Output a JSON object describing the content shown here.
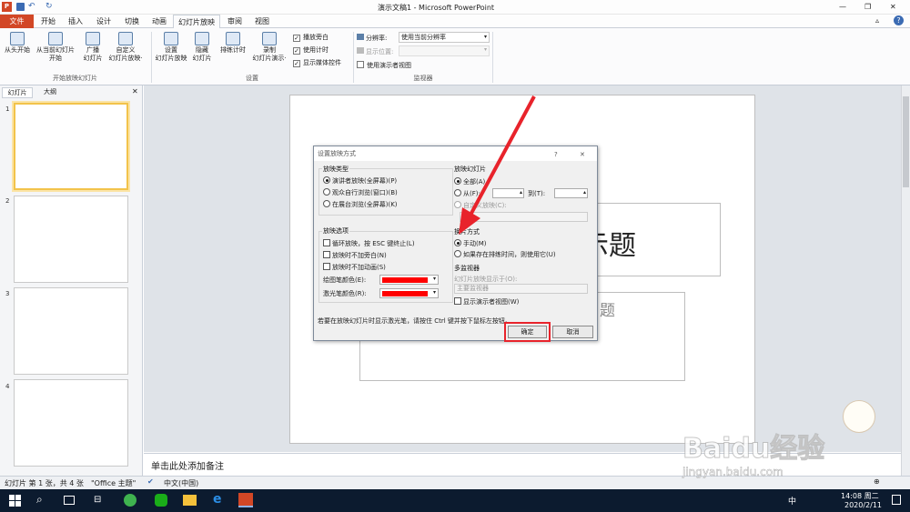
{
  "window": {
    "title": "演示文稿1 - Microsoft PowerPoint",
    "min": "—",
    "max": "❐",
    "close": "✕",
    "help": "?",
    "restore": "▵"
  },
  "tabs": {
    "file": "文件",
    "home": "开始",
    "insert": "插入",
    "design": "设计",
    "transitions": "切换",
    "animations": "动画",
    "slideshow": "幻灯片放映",
    "review": "审阅",
    "view": "视图"
  },
  "ribbon": {
    "from_beginning": "从头开始",
    "from_current": "从当前幻灯片\n开始",
    "broadcast": "广播\n幻灯片",
    "custom": "自定义\n幻灯片放映·",
    "group1": "开始放映幻灯片",
    "setup": "设置\n幻灯片放映",
    "hide": "隐藏\n幻灯片",
    "rehearse": "排练计时",
    "record": "录制\n幻灯片演示·",
    "play_narrations": "播放旁白",
    "use_timings": "使用计时",
    "show_media": "显示媒体控件",
    "group2": "设置",
    "resolution_label": "分辨率:",
    "resolution_value": "使用当前分辨率",
    "show_on_label": "显示位置:",
    "presenter_view": "使用演示者视图",
    "group3": "监视器"
  },
  "leftpane": {
    "tab_slides": "幻灯片",
    "tab_outline": "大纲",
    "close": "✕",
    "slides": [
      "1",
      "2",
      "3",
      "4"
    ]
  },
  "slide": {
    "title_fragment": "示题",
    "subtitle_fragment": "题"
  },
  "notes": {
    "placeholder": "单击此处添加备注"
  },
  "status": {
    "slide_info": "幻灯片 第 1 张，共 4 张",
    "theme": "\"Office 主题\"",
    "language": "中文(中国)",
    "zoom": "⊕"
  },
  "dialog": {
    "title": "设置放映方式",
    "help": "?",
    "close": "✕",
    "show_type": {
      "label": "放映类型",
      "options": [
        "演讲者放映(全屏幕)(P)",
        "观众自行浏览(窗口)(B)",
        "在展台浏览(全屏幕)(K)"
      ],
      "selected": 0
    },
    "show_options": {
      "label": "放映选项",
      "items": [
        "循环放映，按 ESC 键终止(L)",
        "放映时不加旁白(N)",
        "放映时不加动画(S)"
      ],
      "pen_color": "绘图笔颜色(E):",
      "laser_color": "激光笔颜色(R):",
      "swatch": "#ff0000"
    },
    "show_slides": {
      "label": "放映幻灯片",
      "all": "全部(A)",
      "from": "从(F):",
      "to": "到(T):",
      "custom": "自定义放映(C):"
    },
    "advance": {
      "label": "换片方式",
      "manual": "手动(M)",
      "timings": "如果存在排练时间，则使用它(U)"
    },
    "monitors": {
      "label": "多监视器",
      "display_on": "幻灯片放映显示于(O):",
      "monitor_value": "主要监视器",
      "presenter": "显示演示者视图(W)"
    },
    "tip": "若要在放映幻灯片时显示激光笔，请按住 Ctrl 键并按下鼠标左按钮。",
    "ok": "确定",
    "cancel": "取消"
  },
  "taskbar": {
    "time": "14:08 周二",
    "date": "2020/2/11",
    "ime": "中"
  },
  "watermark": {
    "text": "Baidu经验",
    "url": "jingyan.baidu.com"
  },
  "colors": {
    "file_tab": "#d24726",
    "accent_red": "#e8232b",
    "taskbar": "#0c1b2f"
  }
}
